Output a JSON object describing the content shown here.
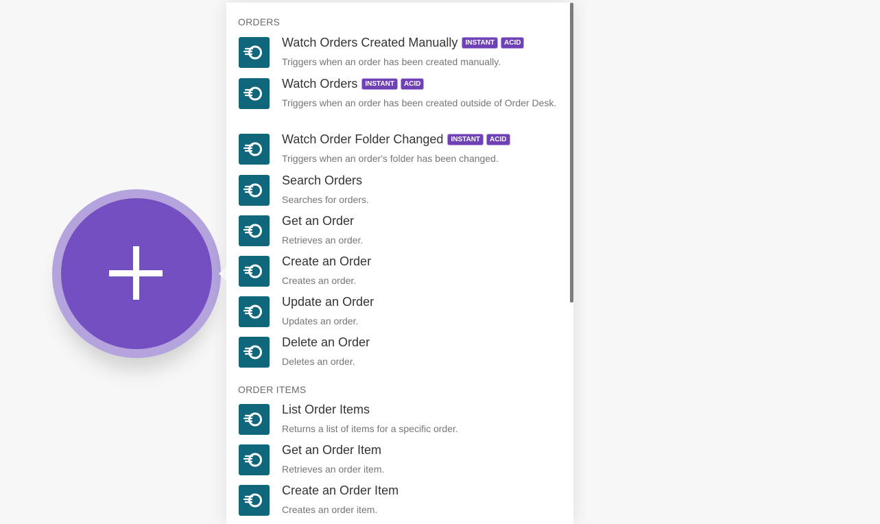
{
  "colors": {
    "app_icon_bg": "#10677c",
    "badge_bg": "#6e41b4",
    "add_circle": "#734fc1",
    "add_circle_ring": "#b4a3dc"
  },
  "add_button": {
    "icon": "plus-icon"
  },
  "sections": [
    {
      "title": "ORDERS",
      "items": [
        {
          "title": "Watch Orders Created Manually",
          "badges": [
            "INSTANT",
            "ACID"
          ],
          "description": "Triggers when an order has been created manually."
        },
        {
          "title": "Watch Orders",
          "badges": [
            "INSTANT",
            "ACID"
          ],
          "description": "Triggers when an order has been created outside of Order Desk."
        },
        {
          "title": "Watch Order Folder Changed",
          "badges": [
            "INSTANT",
            "ACID"
          ],
          "description": "Triggers when an order's folder has been changed."
        },
        {
          "title": "Search Orders",
          "badges": [],
          "description": "Searches for orders."
        },
        {
          "title": "Get an Order",
          "badges": [],
          "description": "Retrieves an order."
        },
        {
          "title": "Create an Order",
          "badges": [],
          "description": "Creates an order."
        },
        {
          "title": "Update an Order",
          "badges": [],
          "description": "Updates an order."
        },
        {
          "title": "Delete an Order",
          "badges": [],
          "description": "Deletes an order."
        }
      ]
    },
    {
      "title": "ORDER ITEMS",
      "items": [
        {
          "title": "List Order Items",
          "badges": [],
          "description": "Returns a list of items for a specific order."
        },
        {
          "title": "Get an Order Item",
          "badges": [],
          "description": "Retrieves an order item."
        },
        {
          "title": "Create an Order Item",
          "badges": [],
          "description": "Creates an order item."
        }
      ]
    }
  ]
}
